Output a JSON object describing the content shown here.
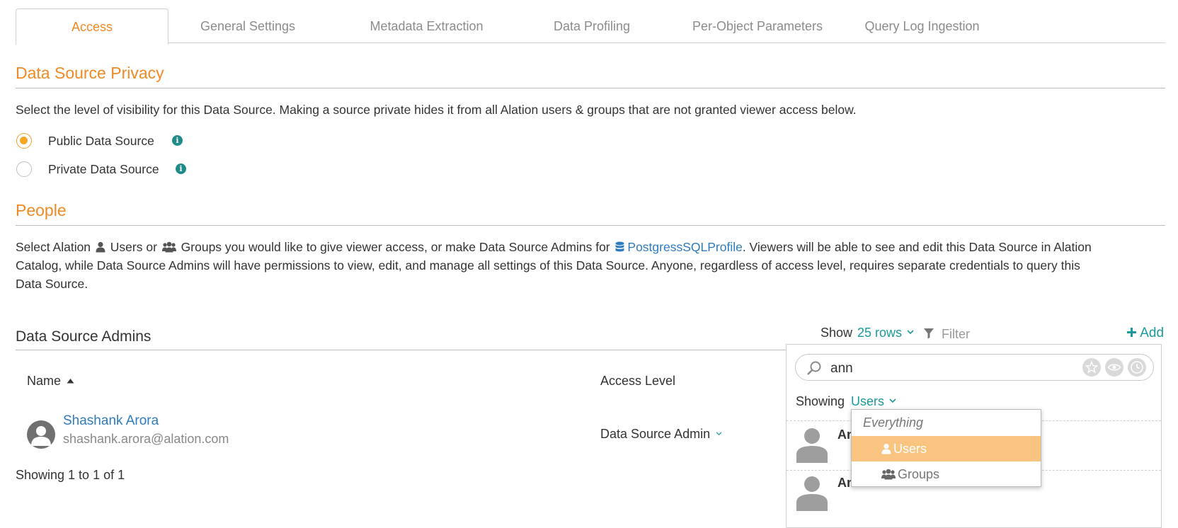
{
  "tabs": [
    "Access",
    "General Settings",
    "Metadata Extraction",
    "Data Profiling",
    "Per-Object Parameters",
    "Query Log Ingestion"
  ],
  "privacy": {
    "title": "Data Source Privacy",
    "description": "Select the level of visibility for this Data Source. Making a source private hides it from all Alation users & groups that are not granted viewer access below.",
    "options": [
      "Public Data Source",
      "Private Data Source"
    ],
    "selected": "Public Data Source"
  },
  "people": {
    "title": "People",
    "desc_1": "Select Alation",
    "desc_users": "Users or",
    "desc_groups": "Groups you would like to give viewer access, or make Data Source Admins for",
    "datasource_link": "PostgressSQLProfile",
    "desc_2": ". Viewers will be able to see and edit this Data Source in Alation",
    "desc_line2": "Catalog, while Data Source Admins will have permissions to view, edit, and manage all settings of this Data Source. Anyone, regardless of access level, requires separate credentials to query this",
    "desc_line3": "Data Source."
  },
  "admins": {
    "title": "Data Source Admins",
    "show_label": "Show",
    "rows_label": "25 rows",
    "filter_placeholder": "Filter",
    "add_label": "Add",
    "col_name": "Name",
    "col_access": "Access Level",
    "rows": [
      {
        "name": "Shashank Arora",
        "email": "shashank.arora@alation.com",
        "access": "Data Source Admin"
      }
    ],
    "footer": "Showing 1 to 1 of 1"
  },
  "picker": {
    "search_value": "ann",
    "showing_label": "Showing",
    "showing_value": "Users",
    "results": [
      "An",
      "Ann Bruce"
    ],
    "menu": [
      "Everything",
      "Users",
      "Groups"
    ],
    "menu_selected": "Users"
  },
  "colors": {
    "accent": "#f08a24",
    "teal": "#1a9a9a",
    "link": "#2f7bbf",
    "highlight": "#f8c47f"
  }
}
